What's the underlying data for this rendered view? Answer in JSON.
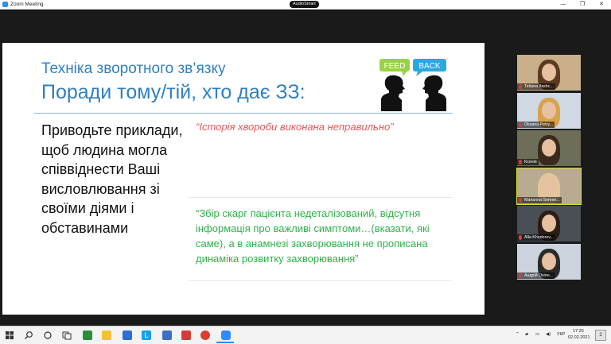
{
  "window": {
    "title": "Zoom Meeting",
    "badge": "AudioSmart",
    "controls": {
      "minimize": "—",
      "restore": "❐",
      "close": "✕"
    }
  },
  "slide": {
    "title": "Техніка зворотного зв’язку",
    "subtitle": "Поради тому/тій, хто дає ЗЗ:",
    "left_text": "Приводьте приклади, щоб людина могла співвіднести Ваші висловлювання зі своїми діями і обставинами",
    "quote_bad": "“Історія хвороби виконана неправильно”",
    "quote_good": "“Збір скарг пацієнта недеталізований, відсутня інформація про важливі симптоми…(вказати, які саме), а в анамнезі захворювання не прописана динаміка розвитку захворювання”",
    "logo_left": "FEED",
    "logo_right": "BACK",
    "colors": {
      "title": "#2f7fc4",
      "bad": "#e5565b",
      "good": "#2db34a"
    }
  },
  "participants": [
    {
      "name": "Tetiana Ilashc...",
      "active": false,
      "bg": "#c9b08a",
      "hair": "#5b3a22"
    },
    {
      "name": "Oksana Petry...",
      "active": false,
      "bg": "#cfd8e3",
      "hair": "#d9a24a"
    },
    {
      "name": "Ксенія",
      "active": false,
      "bg": "#6e6e58",
      "hair": "#3a2a1e"
    },
    {
      "name": "Marianna Semen...",
      "active": true,
      "bg": "#b9aa92",
      "hair": "#e0c69a"
    },
    {
      "name": "Alla Khodorov...",
      "active": false,
      "bg": "#4a4f56",
      "hair": "#2b1d16"
    },
    {
      "name": "Андрій Окіпн...",
      "active": false,
      "bg": "#cdd3dc",
      "hair": "#2a2a2a"
    }
  ],
  "taskbar": {
    "language": "УКР",
    "time": "17:25",
    "date": "02.02.2021",
    "notifications": "2"
  }
}
